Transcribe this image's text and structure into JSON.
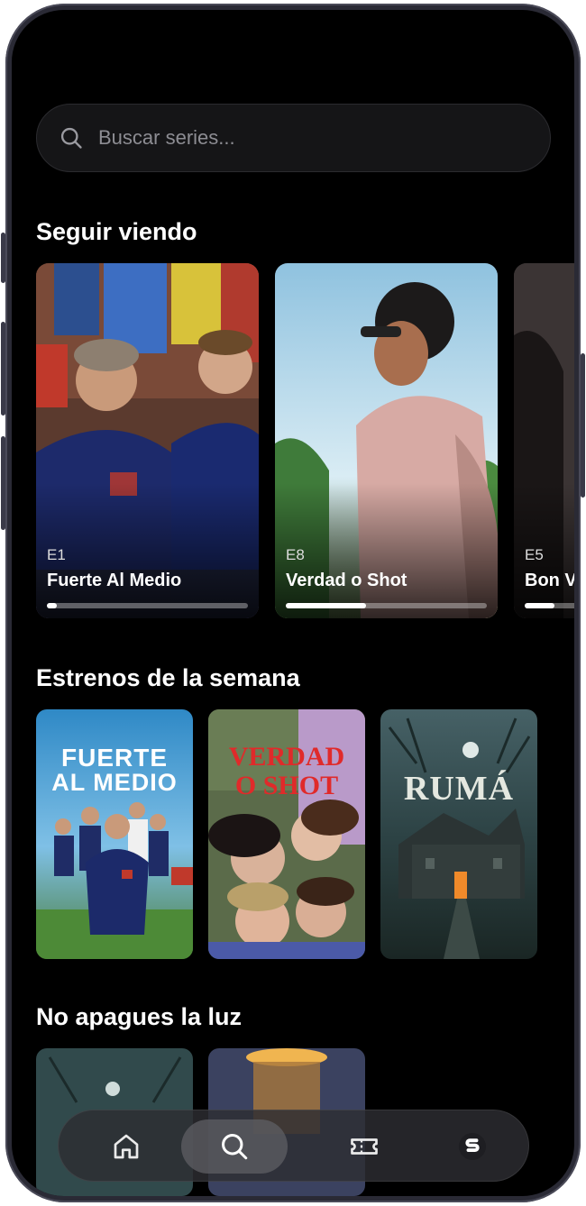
{
  "search": {
    "placeholder": "Buscar series..."
  },
  "sections": {
    "continue_watching": {
      "title": "Seguir viendo",
      "items": [
        {
          "episode": "E1",
          "title": "Fuerte Al Medio",
          "progress": 0.05
        },
        {
          "episode": "E8",
          "title": "Verdad o Shot",
          "progress": 0.4
        },
        {
          "episode": "E5",
          "title": "Bon V",
          "progress": 0.15
        }
      ]
    },
    "new_releases": {
      "title": "Estrenos de la semana",
      "posters": [
        {
          "title_line1": "FUERTE",
          "title_line2": "AL MEDIO"
        },
        {
          "title_line1": "VERDAD",
          "title_line2": "O SHOT"
        },
        {
          "title_line1": "RUMÁ",
          "title_line2": ""
        }
      ]
    },
    "dont_turn_off": {
      "title": "No apagues la luz"
    }
  },
  "nav": {
    "items": [
      {
        "name": "home",
        "icon": "home-icon"
      },
      {
        "name": "search",
        "icon": "search-icon",
        "active": true
      },
      {
        "name": "tickets",
        "icon": "ticket-icon"
      },
      {
        "name": "brand",
        "icon": "brand-logo-icon"
      }
    ]
  },
  "colors": {
    "background": "#000000",
    "progress": "#ffffff",
    "text": "#ffffff"
  }
}
